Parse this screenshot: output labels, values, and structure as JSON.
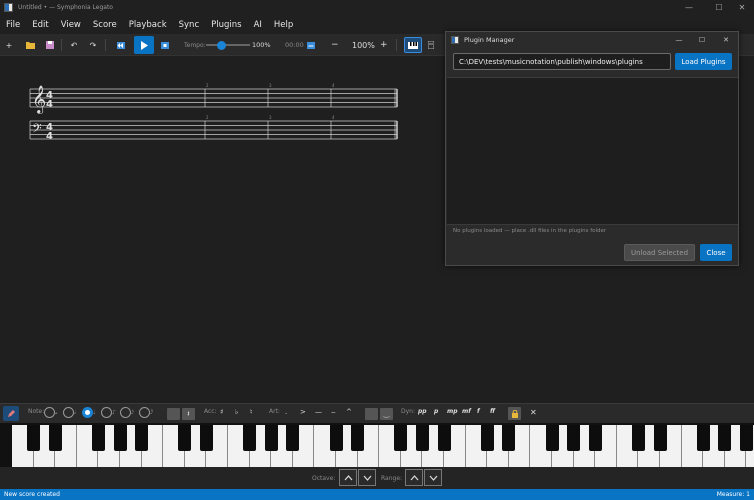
{
  "window": {
    "title": "Untitled • — Symphonia Legato",
    "minimize": "—",
    "maximize": "☐",
    "close": "✕"
  },
  "menu": [
    "File",
    "Edit",
    "View",
    "Score",
    "Playback",
    "Sync",
    "Plugins",
    "AI",
    "Help"
  ],
  "toolbar": {
    "tempo_label": "Tempo:",
    "tempo_value": "100%",
    "tempo_fraction": 0.3,
    "time": "00:00",
    "zoom_minus": "−",
    "zoom_value": "100%",
    "zoom_plus": "+",
    "accent": "#0a74c4"
  },
  "score": {
    "measure_numbers": [
      "2",
      "3",
      "4"
    ],
    "time_sig_top": "4",
    "time_sig_bottom": "4"
  },
  "bottom_toolbar": {
    "note_label": "Note:",
    "note_values": [
      "𝅝",
      "𝅗𝅥",
      "♩",
      "♪",
      "𝅘𝅥𝅯",
      "𝅘𝅥𝅰"
    ],
    "selected_note_index": 2,
    "acc_label": "Acc:",
    "accidentals": [
      "♯",
      "♭",
      "♮"
    ],
    "art_label": "Art:",
    "articulations": [
      ".",
      ">",
      "—",
      "⌢",
      "^"
    ],
    "dyn_label": "Dyn:",
    "dynamics": [
      "pp",
      "p",
      "mp",
      "mf",
      "f",
      "ff"
    ]
  },
  "piano_controls": {
    "octave_label": "Octave:",
    "range_label": "Range:"
  },
  "status": {
    "left": "New score created",
    "right": "Measure: 1"
  },
  "plugin_manager": {
    "title": "Plugin Manager",
    "path": "C:\\DEV\\tests\\musicnotation\\publish\\windows\\plugins",
    "load_button": "Load Plugins",
    "status": "No plugins loaded — place .dll files in the plugins folder",
    "unload_button": "Unload Selected",
    "close_button": "Close"
  }
}
